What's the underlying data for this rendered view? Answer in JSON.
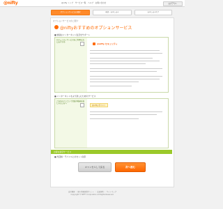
{
  "brand": {
    "logo": "@nifty",
    "accent": "#ff6600",
    "green": "#9bc92a"
  },
  "header": {
    "nav_links": [
      "@nifty トップ",
      "サービス一覧",
      "ヘルプ",
      "お問い合わせ"
    ],
    "util_button": "ログアウト"
  },
  "steps": [
    {
      "label": "オプションサービスの選択",
      "active": true
    },
    {
      "label": "確認・お申し込み",
      "active": false
    },
    {
      "label": "お申し込み完了",
      "active": false
    }
  ],
  "breadcrumb": "オプションサービスのご紹介",
  "page_title": "@niftyおすすめのオプションサービス",
  "sections": [
    {
      "title": "■ 快適なインターネット生活をサポート",
      "box_label": "セキュリティサービスをご利用の方におすすめ",
      "tag": "@nifty セキュリティ",
      "badge": ""
    },
    {
      "title": "■ インターネットをより楽しむためのサービス",
      "box_label": "ご自宅のパソコンで音楽や動画を楽しみたい方へ",
      "tag": "",
      "badge": "@nifty ポイント"
    }
  ],
  "green_bar_label": "お得な割引サービス",
  "section3": {
    "title": "■ 光回線・モバイルとのセット割引",
    "box_label": "通信費をまとめてお得にしたい方へ",
    "tag": "@nifty 割引サービス"
  },
  "buttons": {
    "cancel": "キャンセルして戻る",
    "next": "次へ進む"
  },
  "footer": {
    "links": "会社概要 ｜ 個人情報保護ポリシー ｜ 会員規約 ｜ サイトマップ",
    "copyright": "Copyright © NIFTY Corporation All Rights Reserved."
  }
}
